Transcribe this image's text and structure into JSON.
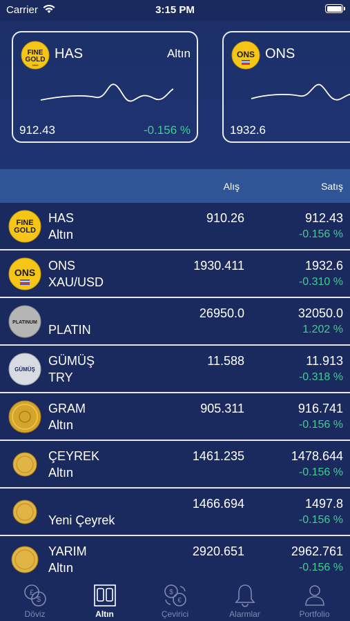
{
  "status_bar": {
    "carrier": "Carrier",
    "time": "3:15 PM"
  },
  "cards": [
    {
      "badge": "FINE GOLD",
      "badge_sub": "9999",
      "name": "HAS",
      "kind": "Altın",
      "price": "912.43",
      "change": "-0.156 %"
    },
    {
      "badge": "ONS",
      "name": "ONS",
      "kind": "",
      "price": "1932.6",
      "change": ""
    }
  ],
  "table_header": {
    "buy": "Alış",
    "sell": "Satış"
  },
  "rows": [
    {
      "badge": "FINE GOLD",
      "line1": "HAS",
      "line2": "Altın",
      "buy": "910.26",
      "sell": "912.43",
      "change": "-0.156 %"
    },
    {
      "badge": "ONS",
      "line1": "ONS",
      "line2": "XAU/USD",
      "buy": "1930.411",
      "sell": "1932.6",
      "change": "-0.310 %"
    },
    {
      "badge": "PLATINUM",
      "line1": "",
      "line2": "PLATIN",
      "buy": "26950.0",
      "sell": "32050.0",
      "change": "1.202 %"
    },
    {
      "badge": "GÜMÜŞ",
      "line1": "GÜMÜŞ",
      "line2": "TRY",
      "buy": "11.588",
      "sell": "11.913",
      "change": "-0.318 %"
    },
    {
      "line1": "GRAM",
      "line2": "Altın",
      "buy": "905.311",
      "sell": "916.741",
      "change": "-0.156 %"
    },
    {
      "line1": "ÇEYREK",
      "line2": "Altın",
      "buy": "1461.235",
      "sell": "1478.644",
      "change": "-0.156 %"
    },
    {
      "line1": "",
      "line2": "Yeni Çeyrek",
      "buy": "1466.694",
      "sell": "1497.8",
      "change": "-0.156 %"
    },
    {
      "line1": "YARIM",
      "line2": "Altın",
      "buy": "2920.651",
      "sell": "2962.761",
      "change": "-0.156 %"
    }
  ],
  "tabs": [
    {
      "label": "Döviz",
      "icon": "currency-coins-icon"
    },
    {
      "label": "Altın",
      "icon": "gold-bars-icon",
      "active": true
    },
    {
      "label": "Çevirici",
      "icon": "converter-icon"
    },
    {
      "label": "Alarmlar",
      "icon": "bell-icon"
    },
    {
      "label": "Portfolio",
      "icon": "person-icon"
    }
  ],
  "colors": {
    "background": "#1a2a5e",
    "header": "#2f5596",
    "positive": "#3fcf8e",
    "gold": "#f5c518"
  }
}
